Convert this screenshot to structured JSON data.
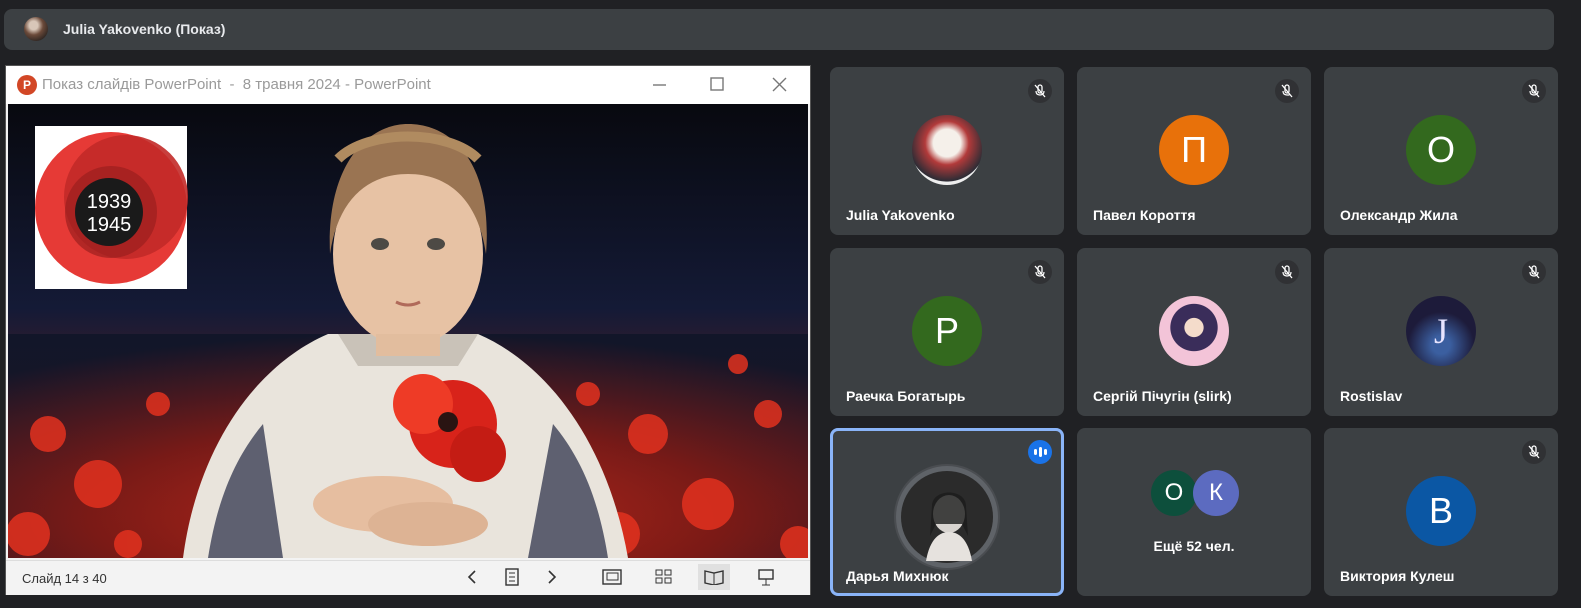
{
  "presenter": {
    "title": "Julia Yakovenko (Показ)"
  },
  "ppt_window": {
    "logo_letter": "P",
    "title": "Показ слайдів PowerPoint  -  8 травня 2024 - PowerPoint",
    "slide_text_top": "1939",
    "slide_text_bottom": "1945",
    "status": "Слайд 14 з 40"
  },
  "participants": [
    {
      "name": "Julia Yakovenko",
      "initial": "",
      "color": "#7b5a4a",
      "muted": true
    },
    {
      "name": "Павел Короття",
      "initial": "П",
      "color": "#e8710a",
      "muted": true
    },
    {
      "name": "Олександр Жила",
      "initial": "О",
      "color": "#33691e",
      "muted": true
    },
    {
      "name": "Раечка Богатырь",
      "initial": "Р",
      "color": "#33691e",
      "muted": true
    },
    {
      "name": "Сергій Пічугін (slirk)",
      "initial": "",
      "color": "#f3c4d8",
      "muted": true
    },
    {
      "name": "Rostislav",
      "initial": "J",
      "color": "#1d1b3a",
      "muted": true
    },
    {
      "name": "Дарья Михнюк",
      "initial": "",
      "color": "#5f6368",
      "muted": false,
      "speaking": true
    },
    {
      "name": "Виктория Кулеш",
      "initial": "В",
      "color": "#0b57a4",
      "muted": true
    }
  ],
  "others": {
    "label": "Ещё 52 чел.",
    "avatars": [
      {
        "initial": "О",
        "color": "#0d4f3c"
      },
      {
        "initial": "К",
        "color": "#5c6bc0"
      }
    ]
  },
  "colors": {
    "accent": "#8ab4f8",
    "background": "#202124",
    "tile": "#3c4043"
  }
}
